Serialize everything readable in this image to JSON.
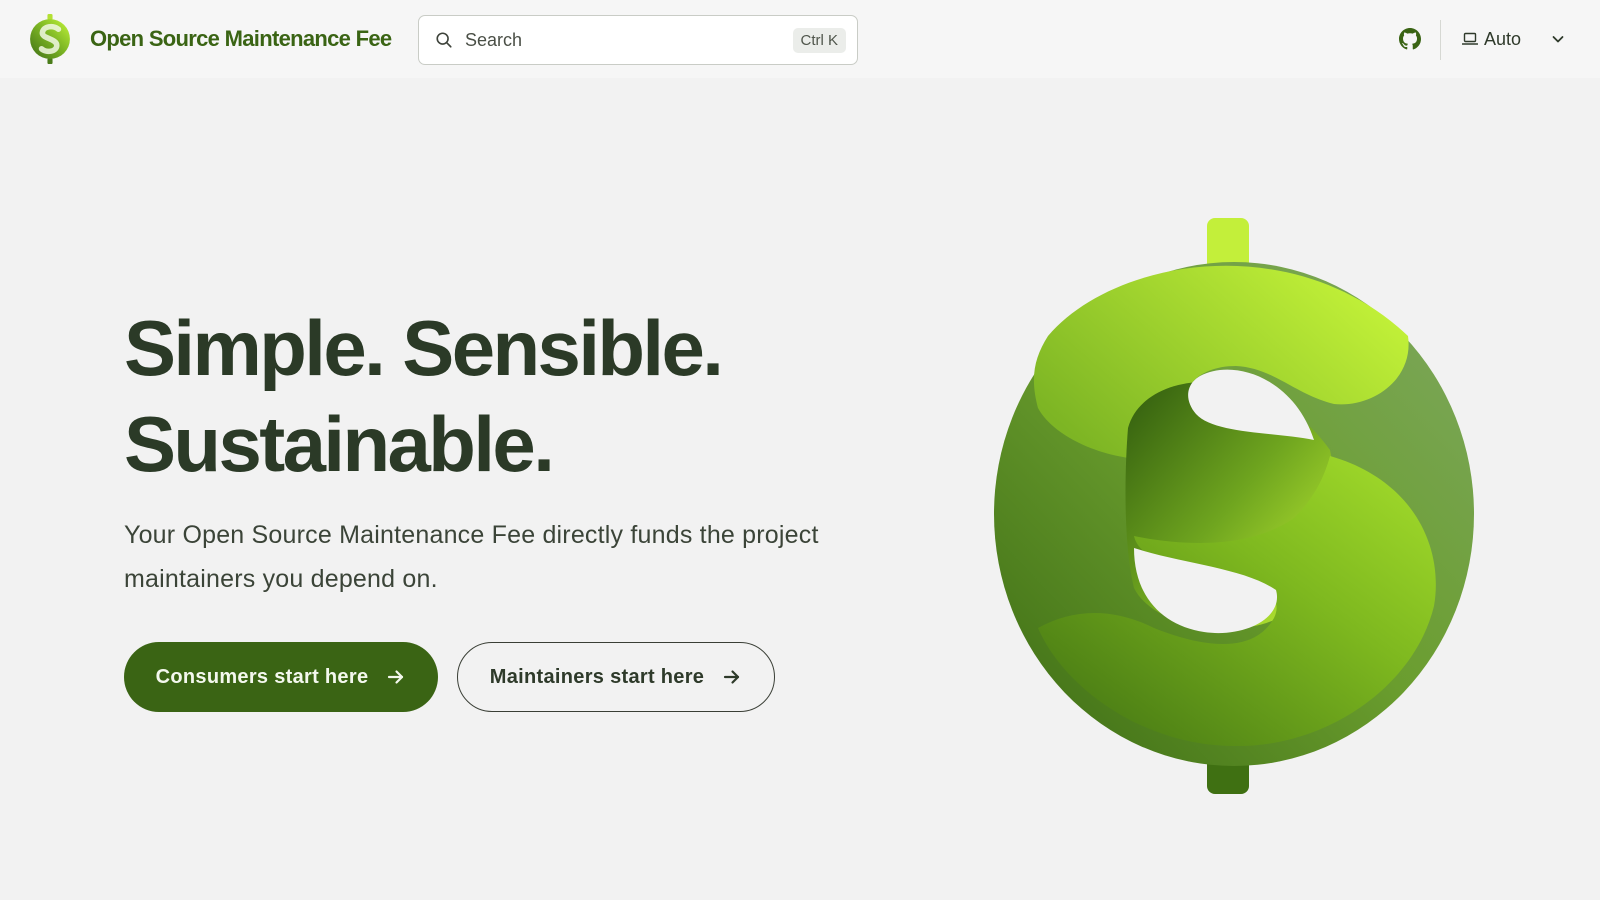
{
  "header": {
    "brand_title": "Open Source Maintenance Fee",
    "search": {
      "placeholder": "Search",
      "shortcut": "Ctrl K"
    },
    "github_icon": "github-icon",
    "theme": {
      "label": "Auto",
      "icon": "laptop-icon"
    }
  },
  "hero": {
    "title_line1": "Simple. Sensible.",
    "title_line2": "Sustainable.",
    "subtitle": "Your Open Source Maintenance Fee directly funds the project maintainers you depend on.",
    "buttons": {
      "primary": "Consumers start here",
      "secondary": "Maintainers start here"
    }
  },
  "colors": {
    "brand": "#3a6414",
    "heading": "#2b3a27",
    "background": "#f2f2f2",
    "logo_light": "#c5f63a",
    "logo_dark": "#3e6e16"
  }
}
